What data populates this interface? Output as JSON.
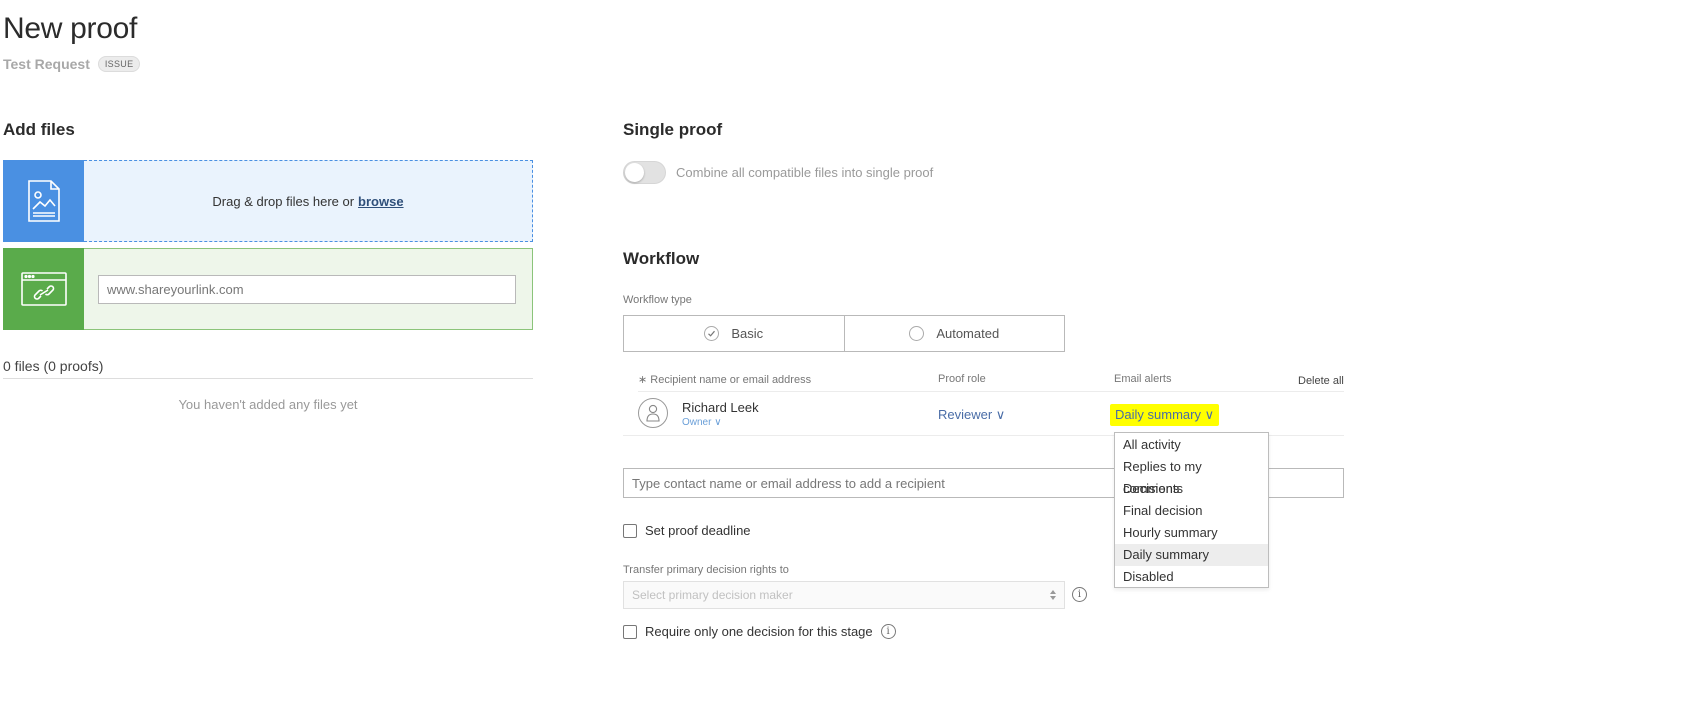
{
  "header": {
    "title": "New proof",
    "subtitle": "Test Request",
    "badge": "ISSUE"
  },
  "add_files": {
    "heading": "Add files",
    "drop_text": "Drag & drop files here or",
    "browse_link": "browse",
    "url_placeholder": "www.shareyourlink.com",
    "files_count": "0 files (0 proofs)",
    "empty_message": "You haven't added any files yet"
  },
  "single_proof": {
    "heading": "Single proof",
    "toggle_on": false,
    "toggle_label": "Combine all compatible files into single proof"
  },
  "workflow": {
    "heading": "Workflow",
    "type_label": "Workflow type",
    "options": [
      {
        "label": "Basic",
        "selected": true
      },
      {
        "label": "Automated",
        "selected": false
      }
    ],
    "columns": {
      "recipient": "∗ Recipient name or email address",
      "role": "Proof role",
      "alerts": "Email alerts"
    },
    "delete_all": "Delete all",
    "recipients": [
      {
        "name": "Richard Leek",
        "owner_label": "Owner ∨",
        "role": "Reviewer ∨",
        "alert": "Daily summary ∨"
      }
    ],
    "add_recipient_placeholder": "Type contact name or email address to add a recipient",
    "set_deadline": "Set proof deadline",
    "transfer_label": "Transfer primary decision rights to",
    "transfer_placeholder": "Select primary decision maker",
    "require_one": "Require only one decision for this stage"
  },
  "alert_dropdown": {
    "selected": "Daily summary",
    "items": [
      "All activity",
      "Replies to my comments",
      "Decisions",
      "Final decision",
      "Hourly summary",
      "Daily summary",
      "Disabled"
    ]
  },
  "colors": {
    "upload_accent": "#4a90e2",
    "link_accent": "#5aab4b",
    "highlight": "#ffff00",
    "link_text": "#4a6da7"
  }
}
